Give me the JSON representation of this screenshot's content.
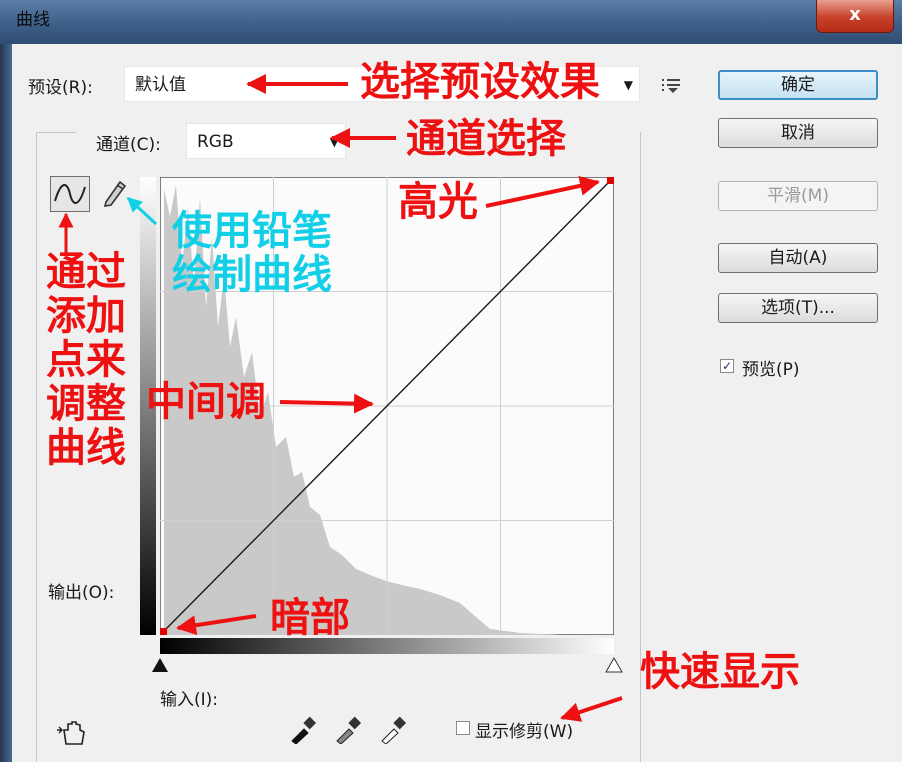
{
  "window": {
    "title": "曲线",
    "close_label": "x"
  },
  "preset": {
    "label": "预设(R):",
    "value": "默认值"
  },
  "channel": {
    "label": "通道(C):",
    "value": "RGB"
  },
  "buttons": {
    "ok": "确定",
    "cancel": "取消",
    "smooth": "平滑(M)",
    "auto": "自动(A)",
    "options": "选项(T)..."
  },
  "preview": {
    "label": "预览(P)",
    "checked": true
  },
  "output_label": "输出(O):",
  "input_label": "输入(I):",
  "show_clipping": {
    "label": "显示修剪(W)",
    "checked": false
  },
  "annotations": {
    "preset": "选择预设效果",
    "channel": "通道选择",
    "pencil_l1": "使用铅笔",
    "pencil_l2": "绘制曲线",
    "points_l1": "通过",
    "points_l2": "添加",
    "points_l3": "点来",
    "points_l4": "调整",
    "points_l5": "曲线",
    "midtone": "中间调",
    "highlight": "高光",
    "shadow": "暗部",
    "clipping": "快速显示"
  },
  "icons": [
    "curve-point-icon",
    "pencil-icon",
    "preset-menu-icon",
    "hand-adjust-icon",
    "black-eyedropper-icon",
    "gray-eyedropper-icon",
    "white-eyedropper-icon"
  ],
  "colors": {
    "annotation_red": "#ee1111",
    "annotation_cyan": "#11cfe6",
    "curve_point": "#e00000"
  }
}
